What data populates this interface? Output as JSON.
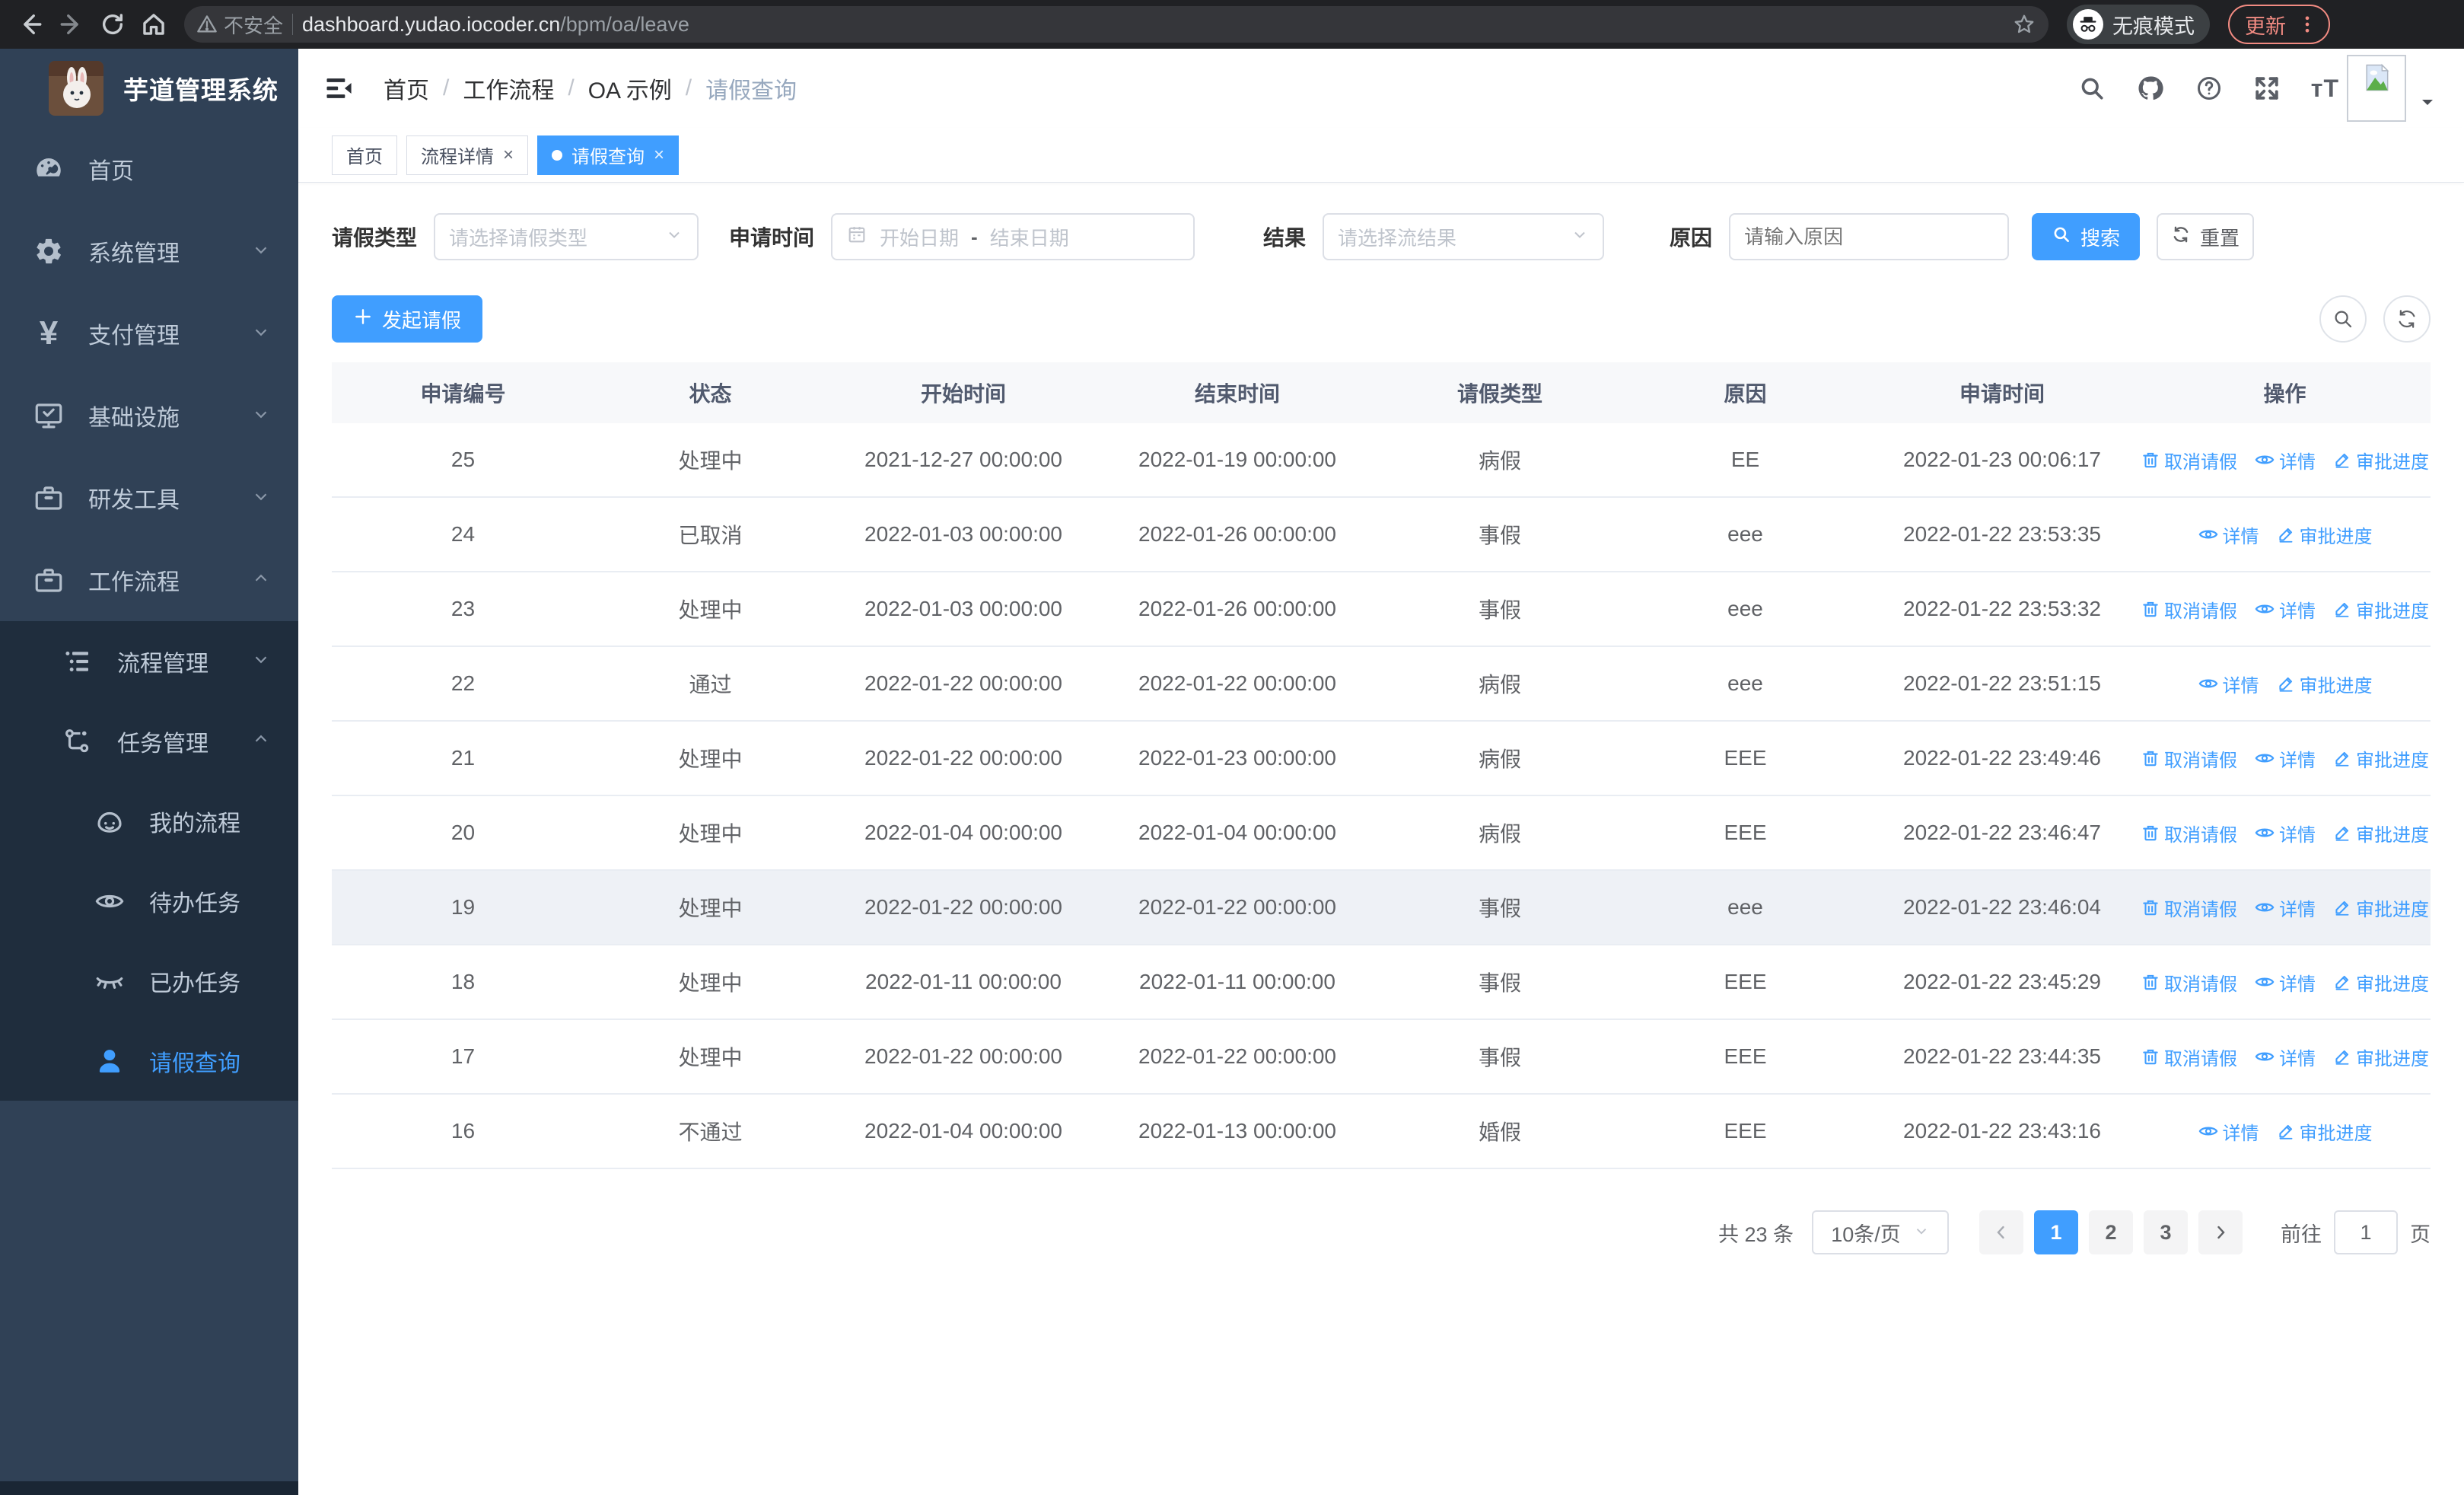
{
  "browser": {
    "security_label": "不安全",
    "url_host": "dashboard.yudao.iocoder.cn",
    "url_path": "/bpm/oa/leave",
    "incognito_label": "无痕模式",
    "update_label": "更新"
  },
  "sidebar": {
    "title": "芋道管理系统",
    "items": [
      {
        "label": "首页",
        "icon": "dashboard-icon",
        "level": 1,
        "chevron": "",
        "submenu": false,
        "active": false
      },
      {
        "label": "系统管理",
        "icon": "gear-icon",
        "level": 1,
        "chevron": "down",
        "submenu": false,
        "active": false
      },
      {
        "label": "支付管理",
        "icon": "yen-icon",
        "level": 1,
        "chevron": "down",
        "submenu": false,
        "active": false
      },
      {
        "label": "基础设施",
        "icon": "monitor-icon",
        "level": 1,
        "chevron": "down",
        "submenu": false,
        "active": false
      },
      {
        "label": "研发工具",
        "icon": "toolbox-icon",
        "level": 1,
        "chevron": "down",
        "submenu": false,
        "active": false
      },
      {
        "label": "工作流程",
        "icon": "briefcase-icon",
        "level": 1,
        "chevron": "up",
        "submenu": false,
        "active": false
      },
      {
        "label": "流程管理",
        "icon": "list-tree-icon",
        "level": 2,
        "chevron": "down",
        "submenu": true,
        "active": false
      },
      {
        "label": "任务管理",
        "icon": "flow-icon",
        "level": 2,
        "chevron": "up",
        "submenu": true,
        "active": false
      },
      {
        "label": "我的流程",
        "icon": "face-icon",
        "level": 3,
        "chevron": "",
        "submenu": true,
        "active": false
      },
      {
        "label": "待办任务",
        "icon": "eye-open-icon",
        "level": 3,
        "chevron": "",
        "submenu": true,
        "active": false
      },
      {
        "label": "已办任务",
        "icon": "eye-closed-icon",
        "level": 3,
        "chevron": "",
        "submenu": true,
        "active": false
      },
      {
        "label": "请假查询",
        "icon": "user-icon",
        "level": 3,
        "chevron": "",
        "submenu": true,
        "active": true
      }
    ]
  },
  "navbar": {
    "breadcrumb": [
      "首页",
      "工作流程",
      "OA 示例",
      "请假查询"
    ]
  },
  "tabs": [
    {
      "label": "首页",
      "closable": false,
      "active": false
    },
    {
      "label": "流程详情",
      "closable": true,
      "active": false
    },
    {
      "label": "请假查询",
      "closable": true,
      "active": true
    }
  ],
  "filters": {
    "leave_type_label": "请假类型",
    "leave_type_placeholder": "请选择请假类型",
    "apply_time_label": "申请时间",
    "start_date_placeholder": "开始日期",
    "range_separator": "-",
    "end_date_placeholder": "结束日期",
    "result_label": "结果",
    "result_placeholder": "请选择流结果",
    "reason_label": "原因",
    "reason_placeholder": "请输入原因",
    "search_label": "搜索",
    "reset_label": "重置"
  },
  "toolbar": {
    "create_label": "发起请假"
  },
  "table": {
    "headers": [
      "申请编号",
      "状态",
      "开始时间",
      "结束时间",
      "请假类型",
      "原因",
      "申请时间",
      "操作"
    ],
    "action_labels": {
      "cancel": "取消请假",
      "detail": "详情",
      "progress": "审批进度"
    },
    "rows": [
      {
        "id": "25",
        "status": "处理中",
        "start": "2021-12-27 00:00:00",
        "end": "2022-01-19 00:00:00",
        "type": "病假",
        "reason": "EE",
        "applied": "2022-01-23 00:06:17",
        "cancelable": true,
        "highlight": false
      },
      {
        "id": "24",
        "status": "已取消",
        "start": "2022-01-03 00:00:00",
        "end": "2022-01-26 00:00:00",
        "type": "事假",
        "reason": "eee",
        "applied": "2022-01-22 23:53:35",
        "cancelable": false,
        "highlight": false
      },
      {
        "id": "23",
        "status": "处理中",
        "start": "2022-01-03 00:00:00",
        "end": "2022-01-26 00:00:00",
        "type": "事假",
        "reason": "eee",
        "applied": "2022-01-22 23:53:32",
        "cancelable": true,
        "highlight": false
      },
      {
        "id": "22",
        "status": "通过",
        "start": "2022-01-22 00:00:00",
        "end": "2022-01-22 00:00:00",
        "type": "病假",
        "reason": "eee",
        "applied": "2022-01-22 23:51:15",
        "cancelable": false,
        "highlight": false
      },
      {
        "id": "21",
        "status": "处理中",
        "start": "2022-01-22 00:00:00",
        "end": "2022-01-23 00:00:00",
        "type": "病假",
        "reason": "EEE",
        "applied": "2022-01-22 23:49:46",
        "cancelable": true,
        "highlight": false
      },
      {
        "id": "20",
        "status": "处理中",
        "start": "2022-01-04 00:00:00",
        "end": "2022-01-04 00:00:00",
        "type": "病假",
        "reason": "EEE",
        "applied": "2022-01-22 23:46:47",
        "cancelable": true,
        "highlight": false
      },
      {
        "id": "19",
        "status": "处理中",
        "start": "2022-01-22 00:00:00",
        "end": "2022-01-22 00:00:00",
        "type": "事假",
        "reason": "eee",
        "applied": "2022-01-22 23:46:04",
        "cancelable": true,
        "highlight": true
      },
      {
        "id": "18",
        "status": "处理中",
        "start": "2022-01-11 00:00:00",
        "end": "2022-01-11 00:00:00",
        "type": "事假",
        "reason": "EEE",
        "applied": "2022-01-22 23:45:29",
        "cancelable": true,
        "highlight": false
      },
      {
        "id": "17",
        "status": "处理中",
        "start": "2022-01-22 00:00:00",
        "end": "2022-01-22 00:00:00",
        "type": "事假",
        "reason": "EEE",
        "applied": "2022-01-22 23:44:35",
        "cancelable": true,
        "highlight": false
      },
      {
        "id": "16",
        "status": "不通过",
        "start": "2022-01-04 00:00:00",
        "end": "2022-01-13 00:00:00",
        "type": "婚假",
        "reason": "EEE",
        "applied": "2022-01-22 23:43:16",
        "cancelable": false,
        "highlight": false
      }
    ]
  },
  "pagination": {
    "total_label": "共 23 条",
    "page_size": "10条/页",
    "pages": [
      "1",
      "2",
      "3"
    ],
    "active_page": "1",
    "goto_label": "前往",
    "goto_value": "1",
    "page_suffix": "页"
  },
  "colors": {
    "primary": "#409eff",
    "sidebar": "#304156",
    "submenu": "#1f2d3d",
    "chrome": "#202124",
    "update_accent": "#f28b82"
  }
}
